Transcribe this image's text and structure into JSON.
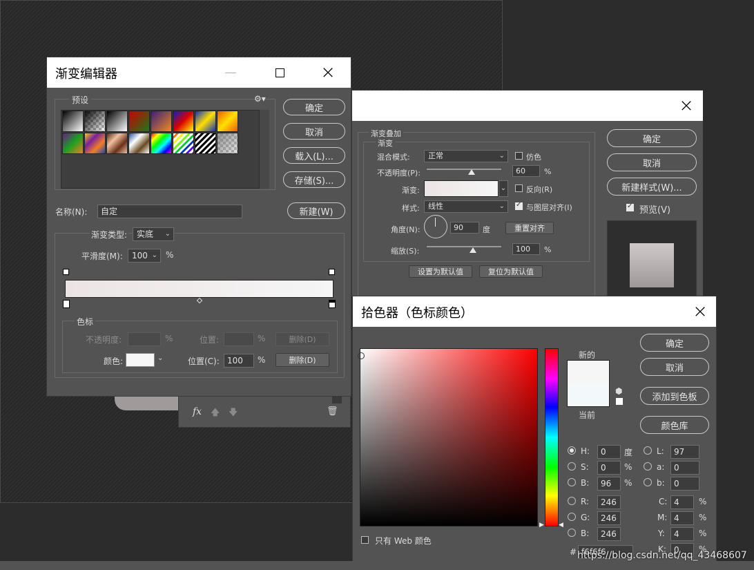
{
  "gradient_editor": {
    "title": "渐变编辑器",
    "presets_label": "预设",
    "ok": "确定",
    "cancel": "取消",
    "load": "载入(L)...",
    "save": "存储(S)...",
    "name_label": "名称(N):",
    "name_value": "自定",
    "new_button": "新建(W)",
    "type_label": "渐变类型:",
    "type_value": "实底",
    "smooth_label": "平滑度(M):",
    "smooth_value": "100",
    "percent": "%",
    "stops_label": "色标",
    "opacity_label": "不透明度:",
    "position_label": "位置:",
    "delete_label": "删除(D)",
    "color_label": "颜色:",
    "position_c_label": "位置(C):",
    "position_c_value": "100",
    "delete_active": "删除(D)",
    "gradient_start": "#ece4e4",
    "gradient_end": "#f6f6f6"
  },
  "layer_style": {
    "group_title": "渐变叠加",
    "sub_title": "渐变",
    "blend_label": "混合模式:",
    "blend_value": "正常",
    "dither_label": "仿色",
    "opacity_label": "不透明度(P):",
    "opacity_value": "60",
    "opacity_level": 0.6,
    "gradient_label": "渐变:",
    "reverse_label": "反向(R)",
    "style_label": "样式:",
    "style_value": "线性",
    "align_label": "与图层对齐(I)",
    "angle_label": "角度(N):",
    "angle_value": "90",
    "degree": "度",
    "reset_align": "重置对齐",
    "scale_label": "缩放(S):",
    "scale_value": "100",
    "scale_level": 1.0,
    "percent": "%",
    "set_default": "设置为默认值",
    "reset_default": "复位为默认值",
    "ok": "确定",
    "cancel": "取消",
    "new_style": "新建样式(W)...",
    "preview_label": "预览(V)"
  },
  "layers_panel": {
    "fx_label": "fx"
  },
  "color_picker": {
    "title": "拾色器（色标颜色）",
    "ok": "确定",
    "cancel": "取消",
    "add_swatch": "添加到色板",
    "color_library": "颜色库",
    "new_label": "新的",
    "current_label": "当前",
    "web_only": "只有 Web 颜色",
    "h_label": "H:",
    "h_value": "0",
    "h_unit": "度",
    "s_label": "S:",
    "s_value": "0",
    "s_unit": "%",
    "b_label": "B:",
    "b_value": "96",
    "b_unit": "%",
    "r_label": "R:",
    "r_value": "246",
    "g_label": "G:",
    "g_value": "246",
    "bb_label": "B:",
    "bb_value": "246",
    "l_label": "L:",
    "l_value": "97",
    "a_label": "a:",
    "a_value": "0",
    "b2_label": "b:",
    "b2_value": "0",
    "c_label": "C:",
    "c_value": "4",
    "m_label": "M:",
    "m_value": "4",
    "y_label": "Y:",
    "y_value": "4",
    "k_label": "K:",
    "k_value": "0",
    "hash": "#",
    "hex_value": "f6f6f6",
    "new_color": "#f6f6f6",
    "current_color": "#f3f9fb"
  },
  "watermark": "https://blog.csdn.net/qq_43468607"
}
